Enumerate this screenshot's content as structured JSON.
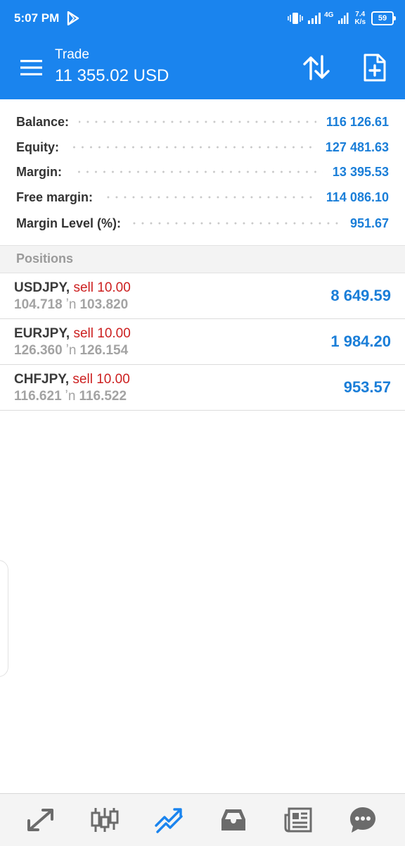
{
  "status_bar": {
    "time": "5:07 PM",
    "net_type": "4G",
    "net_speed_value": "7.4",
    "net_speed_unit": "K/s",
    "battery": "59"
  },
  "app_bar": {
    "title": "Trade",
    "subtitle": "11 355.02 USD"
  },
  "summary": [
    {
      "label": "Balance:",
      "value": "116 126.61"
    },
    {
      "label": "Equity:",
      "value": "127 481.63"
    },
    {
      "label": "Margin:",
      "value": "13 395.53"
    },
    {
      "label": "Free margin:",
      "value": "114 086.10"
    },
    {
      "label": "Margin Level (%):",
      "value": "951.67"
    }
  ],
  "positions_header": "Positions",
  "positions": [
    {
      "symbol": "USDJPY,",
      "type": "sell 10.00",
      "open_price": "104.718",
      "arrow": "ʼn",
      "current_price": "103.820",
      "profit": "8 649.59"
    },
    {
      "symbol": "EURJPY,",
      "type": "sell 10.00",
      "open_price": "126.360",
      "arrow": "ʼn",
      "current_price": "126.154",
      "profit": "1 984.20"
    },
    {
      "symbol": "CHFJPY,",
      "type": "sell 10.00",
      "open_price": "116.621",
      "arrow": "ʼn",
      "current_price": "116.522",
      "profit": "953.57"
    }
  ],
  "colors": {
    "brand": "#1a84ee",
    "value_blue": "#1a7ed8",
    "sell_red": "#cc1f1f",
    "muted_gray": "#a3a3a3",
    "nav_active": "#1a84ee",
    "nav_inactive": "#6b6b6b"
  },
  "icons": {
    "menu": "hamburger-menu-icon",
    "sort": "sort-arrows-icon",
    "new_order": "new-document-plus-icon",
    "nav": [
      "quotes-arrows-icon",
      "chart-candles-icon",
      "trade-trend-icon",
      "history-inbox-icon",
      "news-icon",
      "chat-icon"
    ]
  },
  "bottom_nav_active_index": 2
}
